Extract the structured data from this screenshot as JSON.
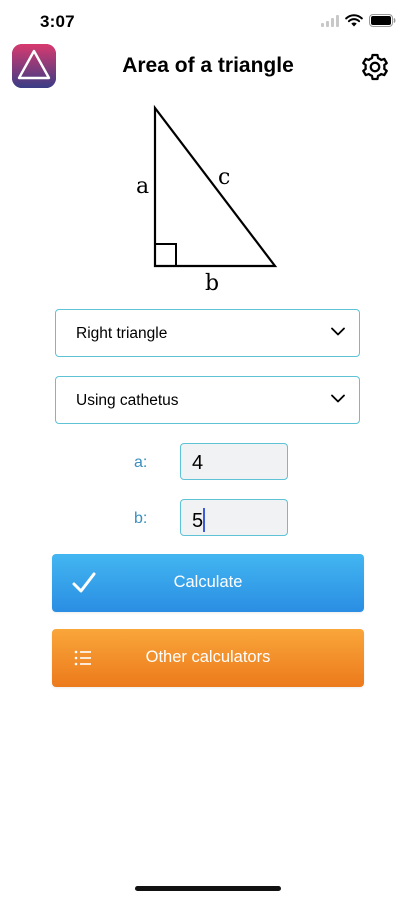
{
  "status_bar": {
    "time": "3:07"
  },
  "header": {
    "title": "Area of a triangle",
    "logo_icon": "triangle-logo-icon",
    "settings_icon": "gear-icon"
  },
  "diagram": {
    "side_a": "a",
    "side_b": "b",
    "side_c": "c"
  },
  "form": {
    "triangle_type": "Right triangle",
    "method": "Using cathetus",
    "inputs": [
      {
        "label": "a:",
        "value": "4"
      },
      {
        "label": "b:",
        "value": "5"
      }
    ]
  },
  "buttons": {
    "calculate": "Calculate",
    "calculate_icon": "checkmark-icon",
    "other": "Other calculators",
    "other_icon": "list-icon"
  },
  "colors": {
    "accent_border": "#5fc3d6",
    "label_blue": "#3a8fbf",
    "calculate_top": "#43b6f1",
    "calculate_bottom": "#2a8ee3",
    "other_top": "#f9a63a",
    "other_bottom": "#ec7a1c"
  }
}
